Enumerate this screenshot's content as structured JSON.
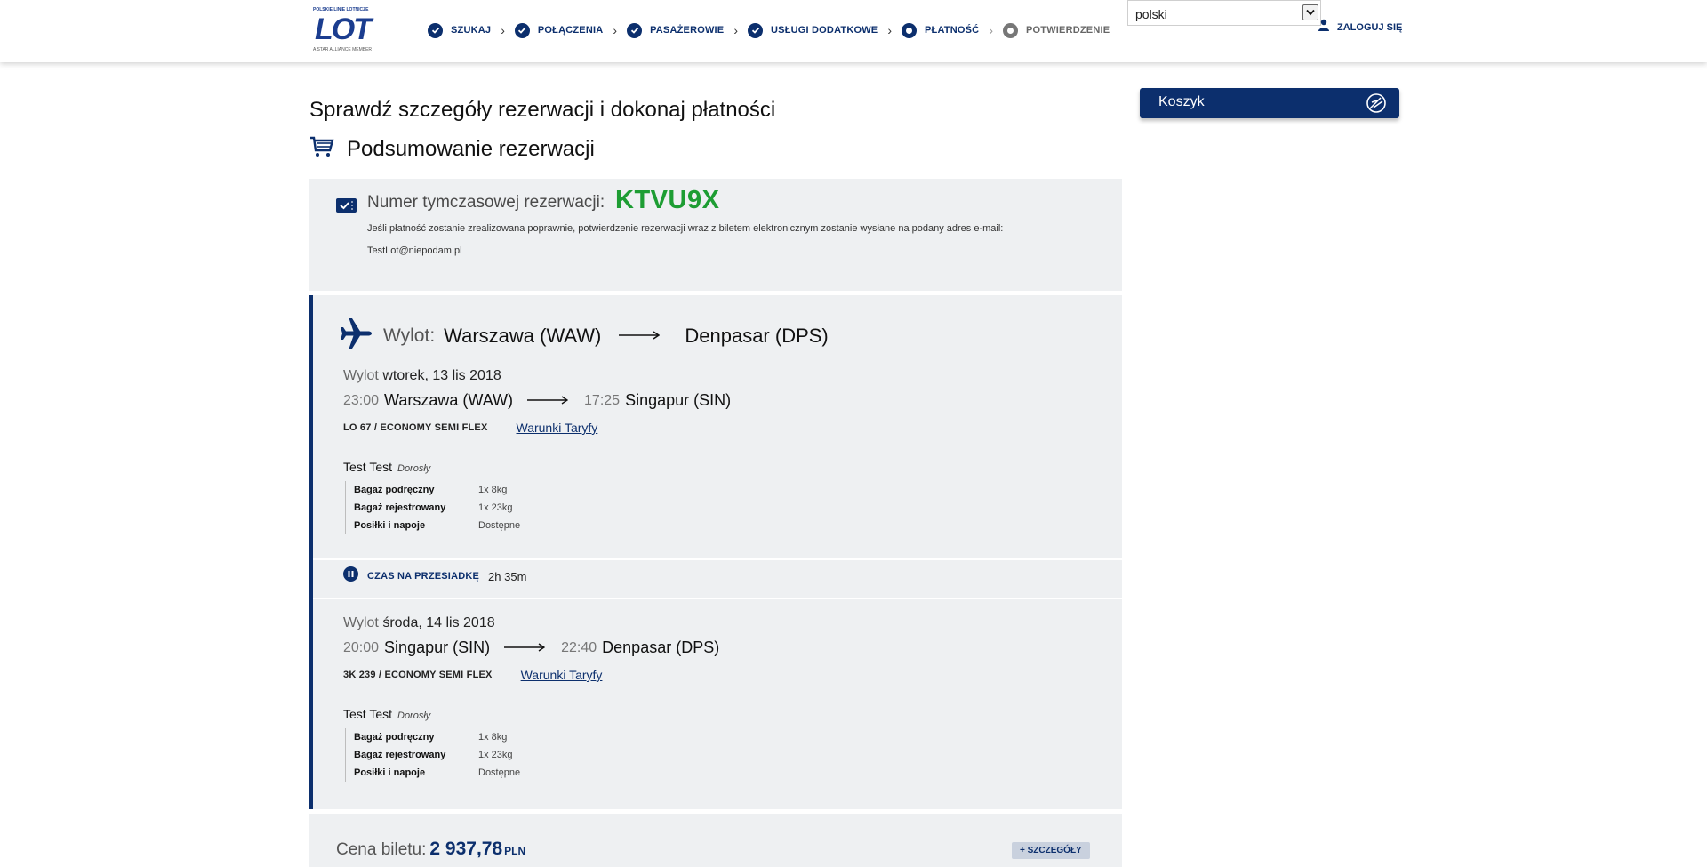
{
  "header": {
    "logo": {
      "tagline": "POLSKIE LINIE LOTNICZE",
      "mark": "LOT",
      "alliance": "A STAR ALLIANCE MEMBER"
    },
    "steps": [
      {
        "label": "SZUKAJ",
        "state": "done"
      },
      {
        "label": "POŁĄCZENIA",
        "state": "done"
      },
      {
        "label": "PASAŻEROWIE",
        "state": "done"
      },
      {
        "label": "USŁUGI DODATKOWE",
        "state": "done"
      },
      {
        "label": "PŁATNOŚĆ",
        "state": "current"
      },
      {
        "label": "POTWIERDZENIE",
        "state": "pending"
      }
    ],
    "language": "polski",
    "login_label": "ZALOGUJ SIĘ"
  },
  "page": {
    "title": "Sprawdź szczegóły rezerwacji i dokonaj płatności",
    "summary_title": "Podsumowanie rezerwacji"
  },
  "reservation": {
    "label": "Numer tymczasowej rezerwacji:",
    "code": "KTVU9X",
    "info": "Jeśli płatność zostanie zrealizowana poprawnie, potwierdzenie rezerwacji wraz z biletem elektronicznym zostanie wysłane na podany adres e-mail:",
    "email": "TestLot@niepodam.pl"
  },
  "flight": {
    "direction_label": "Wylot:",
    "from": "Warszawa (WAW)",
    "to": "Denpasar (DPS)",
    "segments": [
      {
        "date_label": "Wylot",
        "date": "wtorek, 13 lis 2018",
        "dep_time": "23:00",
        "dep_place": "Warszawa (WAW)",
        "arr_time": "17:25",
        "arr_place": "Singapur (SIN)",
        "fare_code": "LO 67 / ECONOMY SEMI FLEX",
        "fare_link": "Warunki Taryfy",
        "passenger": "Test Test",
        "passenger_type": "Dorosły",
        "baggage": [
          {
            "label": "Bagaż podręczny",
            "value": "1x 8kg"
          },
          {
            "label": "Bagaż rejestrowany",
            "value": "1x 23kg"
          },
          {
            "label": "Posiłki i napoje",
            "value": "Dostępne"
          }
        ]
      },
      {
        "date_label": "Wylot",
        "date": "środa, 14 lis 2018",
        "dep_time": "20:00",
        "dep_place": "Singapur (SIN)",
        "arr_time": "22:40",
        "arr_place": "Denpasar (DPS)",
        "fare_code": "3K 239 / ECONOMY SEMI FLEX",
        "fare_link": "Warunki Taryfy",
        "passenger": "Test Test",
        "passenger_type": "Dorosły",
        "baggage": [
          {
            "label": "Bagaż podręczny",
            "value": "1x 8kg"
          },
          {
            "label": "Bagaż rejestrowany",
            "value": "1x 23kg"
          },
          {
            "label": "Posiłki i napoje",
            "value": "Dostępne"
          }
        ]
      }
    ],
    "transfer_label": "CZAS NA PRZESIADKĘ",
    "transfer_time": "2h 35m"
  },
  "price": {
    "label": "Cena biletu:",
    "amount": "2 937,78",
    "currency": "PLN",
    "details_button": "+ SZCZEGÓŁY"
  },
  "cart": {
    "title": "Koszyk"
  },
  "colors": {
    "brand": "#0c2f6d",
    "code_green": "#1d9d33",
    "card_bg": "#eef0f2"
  }
}
